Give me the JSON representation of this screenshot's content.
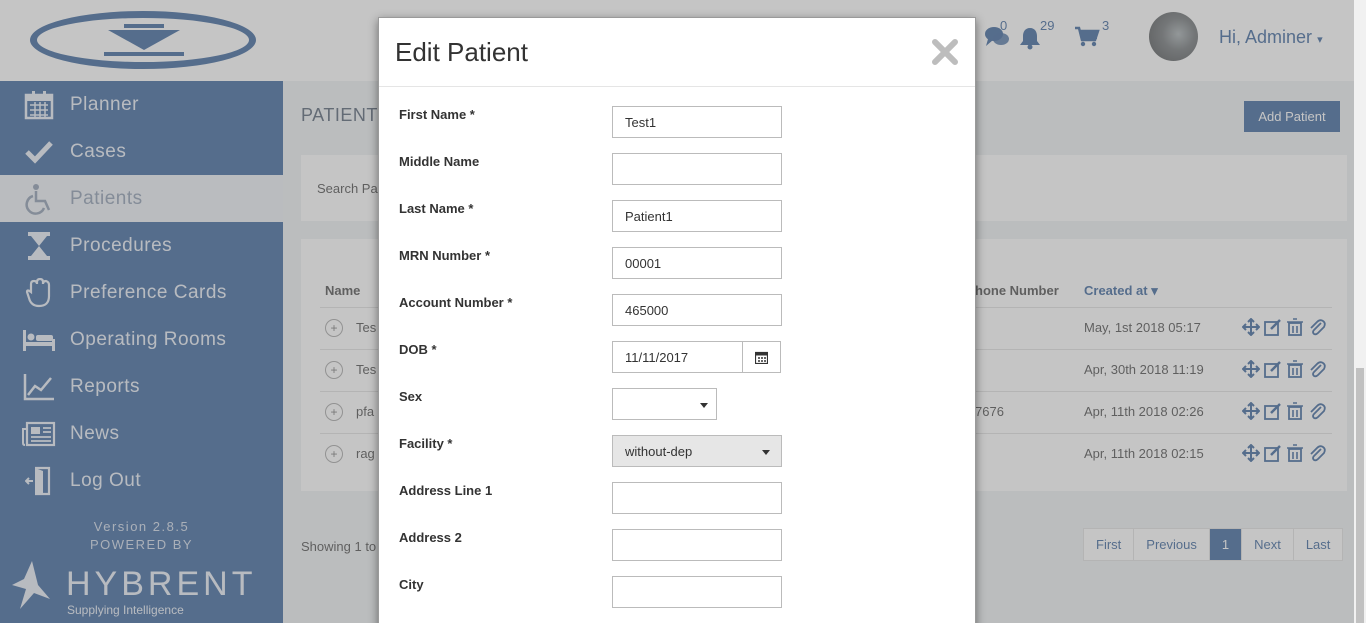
{
  "header": {
    "messages_count": "0",
    "notifications_count": "29",
    "cart_count": "3",
    "user_greeting": "Hi, Adminer"
  },
  "sidebar": {
    "items": [
      {
        "label": "Planner",
        "icon": "calendar-icon"
      },
      {
        "label": "Cases",
        "icon": "check-icon"
      },
      {
        "label": "Patients",
        "icon": "wheelchair-icon",
        "active": true
      },
      {
        "label": "Procedures",
        "icon": "hourglass-icon"
      },
      {
        "label": "Preference Cards",
        "icon": "hand-icon"
      },
      {
        "label": "Operating Rooms",
        "icon": "bed-icon"
      },
      {
        "label": "Reports",
        "icon": "line-chart-icon"
      },
      {
        "label": "News",
        "icon": "newspaper-icon"
      },
      {
        "label": "Log Out",
        "icon": "door-exit-icon"
      }
    ],
    "version": "Version 2.8.5",
    "powered_by": "POWERED BY",
    "brand": "HYBRENT",
    "brand_tagline": "Supplying Intelligence"
  },
  "page": {
    "title": "PATIENTS",
    "add_button": "Add Patient",
    "search_label": "Search Pa",
    "columns": {
      "name": "Name",
      "phone": "hone Number",
      "created": "Created at ▾"
    },
    "rows": [
      {
        "name": "Tes",
        "phone": "",
        "created": "May, 1st 2018 05:17"
      },
      {
        "name": "Tes",
        "phone": "",
        "created": "Apr, 30th 2018 11:19"
      },
      {
        "name": "pfa",
        "phone": "7676",
        "created": "Apr, 11th 2018 02:26"
      },
      {
        "name": "rag",
        "phone": "",
        "created": "Apr, 11th 2018 02:15"
      }
    ],
    "showing": "Showing 1 to",
    "pager": {
      "first": "First",
      "previous": "Previous",
      "current": "1",
      "next": "Next",
      "last": "Last"
    }
  },
  "modal": {
    "title": "Edit Patient",
    "fields": {
      "first_name": {
        "label": "First Name *",
        "value": "Test1"
      },
      "middle_name": {
        "label": "Middle Name",
        "value": ""
      },
      "last_name": {
        "label": "Last Name *",
        "value": "Patient1"
      },
      "mrn": {
        "label": "MRN Number *",
        "value": "00001"
      },
      "account": {
        "label": "Account Number *",
        "value": "465000"
      },
      "dob": {
        "label": "DOB *",
        "value": "11/11/2017"
      },
      "sex": {
        "label": "Sex",
        "value": ""
      },
      "facility": {
        "label": "Facility *",
        "value": "without-dep"
      },
      "address1": {
        "label": "Address Line 1",
        "value": ""
      },
      "address2": {
        "label": "Address 2",
        "value": ""
      },
      "city": {
        "label": "City",
        "value": ""
      }
    }
  },
  "colors": {
    "primary": "#1f4e8c",
    "content_bg": "#ebeef1"
  }
}
